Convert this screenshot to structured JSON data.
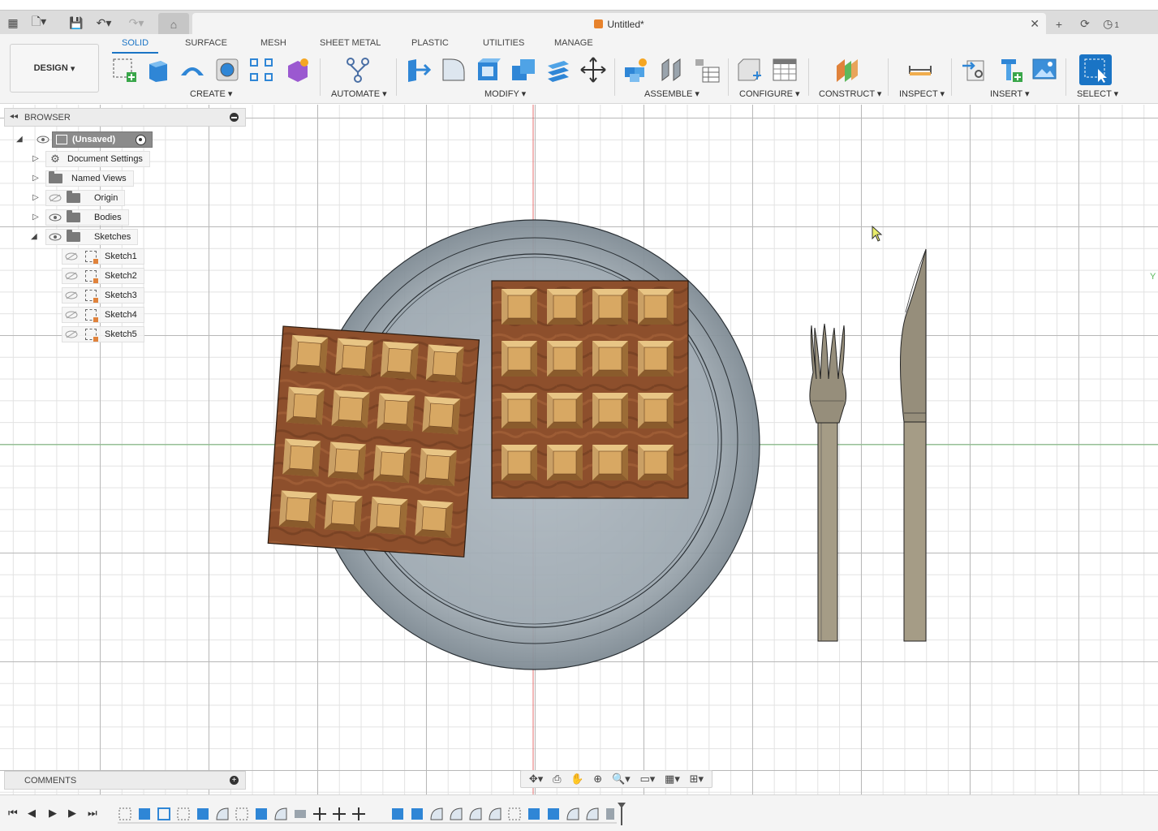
{
  "window": {
    "doc_title": "Untitled*",
    "notification_count": "1"
  },
  "toolbar": {
    "workspace": "DESIGN",
    "tabs": [
      "SOLID",
      "SURFACE",
      "MESH",
      "SHEET METAL",
      "PLASTIC",
      "UTILITIES",
      "MANAGE"
    ],
    "active_tab": "SOLID",
    "groups": {
      "create": "CREATE",
      "automate": "AUTOMATE",
      "modify": "MODIFY",
      "assemble": "ASSEMBLE",
      "configure": "CONFIGURE",
      "construct": "CONSTRUCT",
      "inspect": "INSPECT",
      "insert": "INSERT",
      "select": "SELECT"
    }
  },
  "browser": {
    "title": "BROWSER",
    "root": "(Unsaved)",
    "items": [
      {
        "label": "Document Settings"
      },
      {
        "label": "Named Views"
      },
      {
        "label": "Origin"
      },
      {
        "label": "Bodies"
      },
      {
        "label": "Sketches"
      }
    ],
    "sketches": [
      "Sketch1",
      "Sketch2",
      "Sketch3",
      "Sketch4",
      "Sketch5"
    ]
  },
  "comments": {
    "title": "COMMENTS"
  },
  "viewport": {
    "axis_label": "Y"
  },
  "colors": {
    "accent": "#1a74c5",
    "plate": "#8d98a0",
    "waffle_dark": "#8a4a2a",
    "waffle_light": "#d9a85e",
    "cutlery": "#a59c86"
  }
}
